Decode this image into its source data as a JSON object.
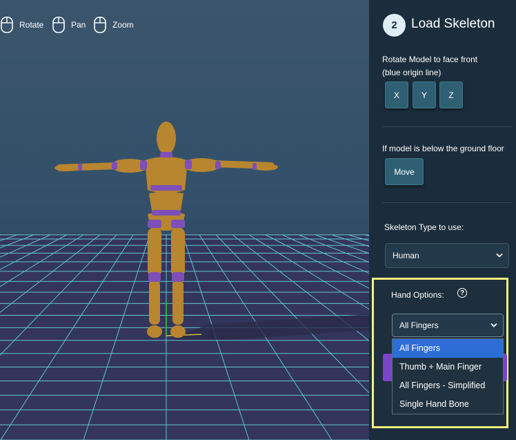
{
  "viewport": {
    "controls": [
      {
        "label": "Rotate",
        "icon": "mouse-icon"
      },
      {
        "label": "Pan",
        "icon": "mouse-icon"
      },
      {
        "label": "Zoom",
        "icon": "mouse-icon"
      }
    ]
  },
  "panel": {
    "step_number": "2",
    "step_title": "Load Skeleton",
    "rotate_text_line1": "Rotate Model to face front",
    "rotate_text_line2": "(blue origin line)",
    "axis_buttons": [
      "X",
      "Y",
      "Z"
    ],
    "ground_text": "If model is below the ground floor",
    "move_button": "Move",
    "skeleton_type_label": "Skeleton Type to use:",
    "skeleton_type_value": "Human",
    "hand_options_label": "Hand Options:",
    "hand_options_value": "All Fingers",
    "hand_options_list": [
      "All Fingers",
      "Thumb + Main Finger",
      "All Fingers - Simplified",
      "Single Hand Bone"
    ],
    "hand_options_selected_index": 0
  },
  "colors": {
    "highlight": "#f7f27e",
    "selected_option": "#2d6dd6",
    "model_body": "#b8862f",
    "model_joint": "#7e4fb8",
    "grid": "#5fc6d1"
  }
}
